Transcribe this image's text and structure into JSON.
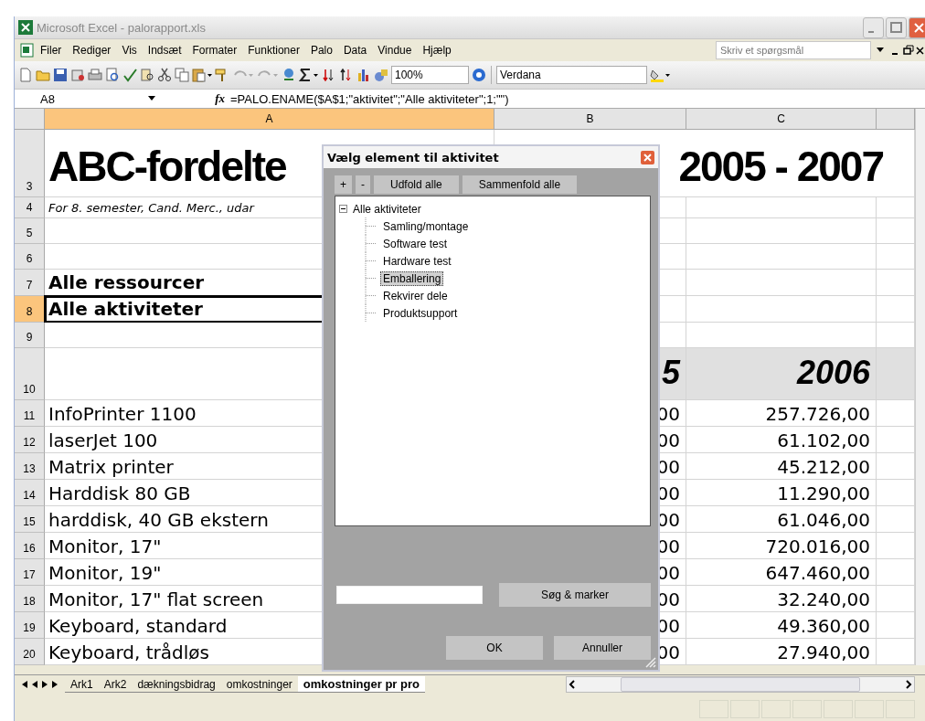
{
  "window": {
    "title": "Microsoft Excel - palorapport.xls"
  },
  "menu": [
    {
      "label": "Filer"
    },
    {
      "label": "Rediger"
    },
    {
      "label": "Vis"
    },
    {
      "label": "Indsæt"
    },
    {
      "label": "Formater"
    },
    {
      "label": "Funktioner"
    },
    {
      "label": "Palo"
    },
    {
      "label": "Data"
    },
    {
      "label": "Vindue"
    },
    {
      "label": "Hjælp"
    }
  ],
  "help_search": {
    "placeholder": "Skriv et spørgsmål"
  },
  "toolbar": {
    "zoom": "100%",
    "font": "Verdana"
  },
  "formula_bar": {
    "name_box": "A8",
    "fx": "fx",
    "formula": "=PALO.ENAME($A$1;\"aktivitet\";\"Alle aktiviteter\";1;\"\")"
  },
  "columns": [
    {
      "label": "A",
      "selected": true
    },
    {
      "label": "B",
      "selected": false
    },
    {
      "label": "C",
      "selected": false
    }
  ],
  "rows": [
    {
      "number": "3",
      "kind": "title",
      "selected": false,
      "a": "ABC-fordelte",
      "bc": "2005 - 2007"
    },
    {
      "number": "4",
      "kind": "subtitle",
      "selected": false,
      "a": "For 8. semester, Cand. Merc., udar"
    },
    {
      "number": "5",
      "kind": "blank",
      "selected": false
    },
    {
      "number": "6",
      "kind": "blank",
      "selected": false
    },
    {
      "number": "7",
      "kind": "heading",
      "selected": false,
      "a": "Alle ressourcer"
    },
    {
      "number": "8",
      "kind": "heading",
      "selected": true,
      "a": "Alle aktiviteter"
    },
    {
      "number": "9",
      "kind": "blank",
      "selected": false
    },
    {
      "number": "10",
      "kind": "year",
      "selected": false,
      "b": "5",
      "c": "2006"
    },
    {
      "number": "11",
      "kind": "data",
      "selected": false,
      "a": "InfoPrinter 1100",
      "b": "00",
      "c": "257.726,00"
    },
    {
      "number": "12",
      "kind": "data",
      "selected": false,
      "a": "laserJet 100",
      "b": "00",
      "c": "61.102,00"
    },
    {
      "number": "13",
      "kind": "data",
      "selected": false,
      "a": "Matrix printer",
      "b": "00",
      "c": "45.212,00"
    },
    {
      "number": "14",
      "kind": "data",
      "selected": false,
      "a": "Harddisk 80 GB",
      "b": "00",
      "c": "11.290,00"
    },
    {
      "number": "15",
      "kind": "data",
      "selected": false,
      "a": "harddisk, 40 GB ekstern",
      "b": "00",
      "c": "61.046,00"
    },
    {
      "number": "16",
      "kind": "data",
      "selected": false,
      "a": "Monitor, 17\"",
      "b": "00",
      "c": "720.016,00"
    },
    {
      "number": "17",
      "kind": "data",
      "selected": false,
      "a": "Monitor, 19\"",
      "b": "00",
      "c": "647.460,00"
    },
    {
      "number": "18",
      "kind": "data",
      "selected": false,
      "a": "Monitor, 17\" flat screen",
      "b": "00",
      "c": "32.240,00"
    },
    {
      "number": "19",
      "kind": "data",
      "selected": false,
      "a": "Keyboard, standard",
      "b": "00",
      "c": "49.360,00"
    },
    {
      "number": "20",
      "kind": "data",
      "selected": false,
      "a": "Keyboard, trådløs",
      "b": "00",
      "c": "27.940,00"
    }
  ],
  "sheet_tabs": [
    {
      "label": "Ark1",
      "selected": false
    },
    {
      "label": "Ark2",
      "selected": false
    },
    {
      "label": "dækningsbidrag",
      "selected": false
    },
    {
      "label": "omkostninger",
      "selected": false
    },
    {
      "label": "omkostninger pr pro",
      "selected": true
    }
  ],
  "dialog": {
    "title": "Vælg element til aktivitet",
    "tool_buttons": [
      "+",
      "-",
      "Udfold alle",
      "Sammenfold alle"
    ],
    "tree": [
      {
        "label": "Alle aktiviteter",
        "expanded": true,
        "selected": false,
        "children": [
          {
            "label": "Samling/montage",
            "selected": false
          },
          {
            "label": "Software test",
            "selected": false
          },
          {
            "label": "Hardware test",
            "selected": false
          },
          {
            "label": "Emballering",
            "selected": true
          },
          {
            "label": "Rekvirer dele",
            "selected": false
          },
          {
            "label": "Produktsupport",
            "selected": false
          }
        ]
      }
    ],
    "search_button": "Søg & marker",
    "ok": "OK",
    "cancel": "Annuller"
  }
}
